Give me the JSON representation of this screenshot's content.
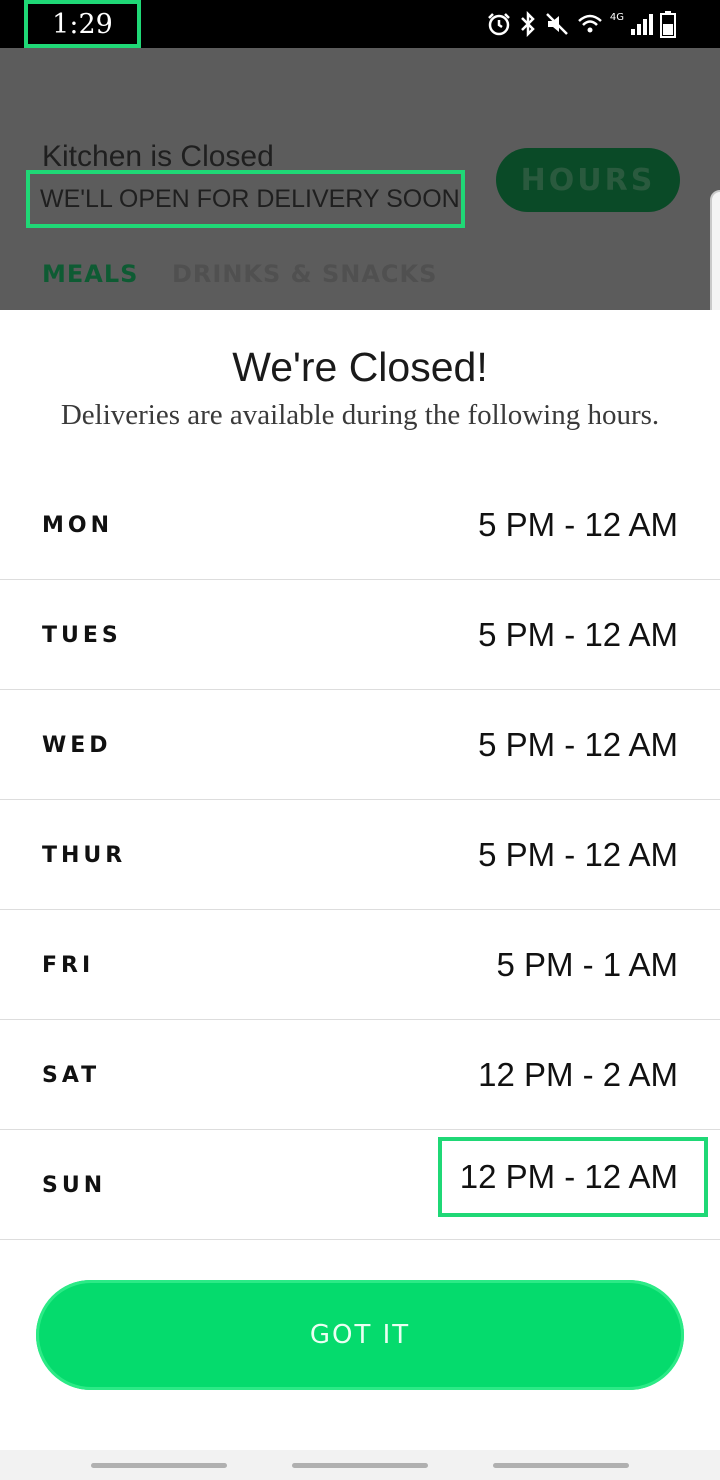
{
  "status_bar": {
    "time": "1:29",
    "network_label": "4G",
    "icons": [
      "alarm-icon",
      "bluetooth-icon",
      "mute-icon",
      "wifi-icon",
      "signal-icon",
      "battery-icon"
    ]
  },
  "background_app": {
    "title": "Kitchen is Closed",
    "subtitle": "WE'LL OPEN FOR DELIVERY SOON",
    "hours_button_label": "HOURS",
    "tabs": [
      {
        "label": "MEALS",
        "active": true
      },
      {
        "label": "DRINKS & SNACKS",
        "active": false
      }
    ]
  },
  "modal": {
    "title": "We're Closed!",
    "subtitle": "Deliveries are available during the following hours.",
    "hours": [
      {
        "day": "MON",
        "time": "5 PM - 12 AM"
      },
      {
        "day": "TUES",
        "time": "5 PM - 12 AM"
      },
      {
        "day": "WED",
        "time": "5 PM - 12 AM"
      },
      {
        "day": "THUR",
        "time": "5 PM - 12 AM"
      },
      {
        "day": "FRI",
        "time": "5 PM - 1 AM"
      },
      {
        "day": "SAT",
        "time": "12 PM - 2 AM"
      },
      {
        "day": "SUN",
        "time": "12 PM - 12 AM"
      }
    ],
    "button_label": "GOT IT"
  },
  "colors": {
    "accent": "#05db6d",
    "highlight_box": "#1fd876",
    "overlay": "#5c5c5c",
    "dark_green": "#0a4a27"
  }
}
